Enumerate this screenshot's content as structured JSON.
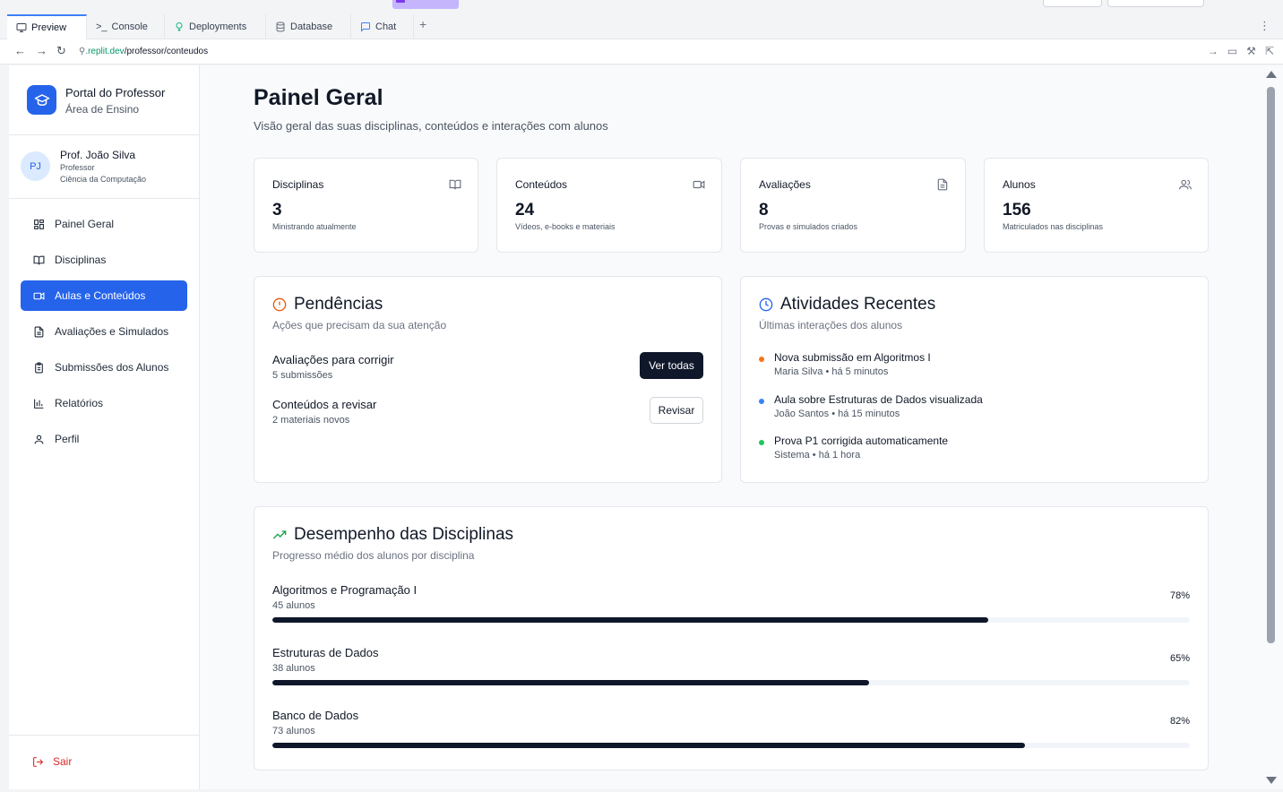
{
  "ide": {
    "tabs": [
      {
        "label": "Preview",
        "icon": "monitor-icon"
      },
      {
        "label": "Console",
        "icon": "terminal-icon"
      },
      {
        "label": "Deployments",
        "icon": "deploy-icon"
      },
      {
        "label": "Database",
        "icon": "database-icon"
      },
      {
        "label": "Chat",
        "icon": "chat-icon"
      }
    ],
    "add_tab": "+",
    "url_host": ".replit.dev",
    "url_path": "/professor/conteudos"
  },
  "sidebar": {
    "title": "Portal do Professor",
    "subtitle": "Área de Ensino",
    "user": {
      "initials": "PJ",
      "name": "Prof. João Silva",
      "role": "Professor",
      "department": "Ciência da Computação"
    },
    "items": [
      {
        "label": "Painel Geral",
        "icon": "dashboard-icon"
      },
      {
        "label": "Disciplinas",
        "icon": "book-icon"
      },
      {
        "label": "Aulas e Conteúdos",
        "icon": "video-icon"
      },
      {
        "label": "Avaliações e Simulados",
        "icon": "file-icon"
      },
      {
        "label": "Submissões dos Alunos",
        "icon": "clipboard-icon"
      },
      {
        "label": "Relatórios",
        "icon": "bar-chart-icon"
      },
      {
        "label": "Perfil",
        "icon": "user-icon"
      }
    ],
    "active_index": 2,
    "logout": "Sair"
  },
  "main": {
    "title": "Painel Geral",
    "subtitle": "Visão geral das suas disciplinas, conteúdos e interações com alunos",
    "stats": [
      {
        "label": "Disciplinas",
        "value": "3",
        "desc": "Ministrando atualmente",
        "icon": "book-icon"
      },
      {
        "label": "Conteúdos",
        "value": "24",
        "desc": "Vídeos, e-books e materiais",
        "icon": "video-icon"
      },
      {
        "label": "Avaliações",
        "value": "8",
        "desc": "Provas e simulados criados",
        "icon": "file-icon"
      },
      {
        "label": "Alunos",
        "value": "156",
        "desc": "Matriculados nas disciplinas",
        "icon": "users-icon"
      }
    ],
    "pending": {
      "title": "Pendências",
      "subtitle": "Ações que precisam da sua atenção",
      "items": [
        {
          "title": "Avaliações para corrigir",
          "desc": "5 submissões",
          "action": "Ver todas"
        },
        {
          "title": "Conteúdos a revisar",
          "desc": "2 materiais novos",
          "action": "Revisar"
        }
      ]
    },
    "activity": {
      "title": "Atividades Recentes",
      "subtitle": "Últimas interações dos alunos",
      "items": [
        {
          "title": "Nova submissão em Algoritmos I",
          "meta": "Maria Silva • há 5 minutos",
          "color": "#f97316"
        },
        {
          "title": "Aula sobre Estruturas de Dados visualizada",
          "meta": "João Santos • há 15 minutos",
          "color": "#3b82f6"
        },
        {
          "title": "Prova P1 corrigida automaticamente",
          "meta": "Sistema • há 1 hora",
          "color": "#22c55e"
        }
      ]
    },
    "performance": {
      "title": "Desempenho das Disciplinas",
      "subtitle": "Progresso médio dos alunos por disciplina",
      "items": [
        {
          "name": "Algoritmos e Programação I",
          "students": "45 alunos",
          "percent_label": "78%",
          "percent": 78
        },
        {
          "name": "Estruturas de Dados",
          "students": "38 alunos",
          "percent_label": "65%",
          "percent": 65
        },
        {
          "name": "Banco de Dados",
          "students": "73 alunos",
          "percent_label": "82%",
          "percent": 82
        }
      ]
    }
  },
  "colors": {
    "primary": "#2563eb",
    "dark_button": "#0f172a",
    "warning": "#ea580c",
    "clock": "#2563eb",
    "trend": "#16a34a",
    "danger": "#dc2626"
  }
}
